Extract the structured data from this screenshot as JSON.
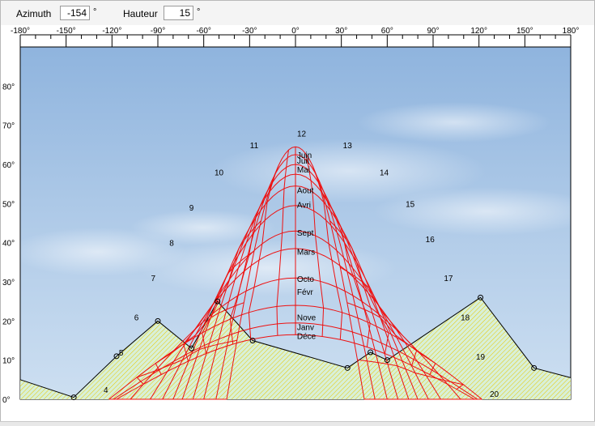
{
  "toolbar": {
    "azimuth_label": "Azimuth",
    "azimuth_value": "-154",
    "azimuth_unit": "°",
    "hauteur_label": "Hauteur",
    "hauteur_value": "15",
    "hauteur_unit": "°"
  },
  "colors": {
    "sun_path_lines": "#ee1111",
    "horizon_line": "#000000",
    "horizon_fill": "#d8f0d8",
    "horizon_hatch": "#e8c800",
    "sky_top": "#8fb4de",
    "sky_bottom": "#cddff1"
  },
  "chart_data": {
    "type": "sun-path-diagram",
    "x_axis": {
      "range": [
        -180,
        180
      ],
      "ticks": [
        -180,
        -150,
        -120,
        -90,
        -60,
        -30,
        0,
        30,
        60,
        90,
        120,
        150,
        180
      ],
      "tick_labels": [
        "-180°",
        "-150°",
        "-120°",
        "-90°",
        "-60°",
        "-30°",
        "0°",
        "30°",
        "60°",
        "90°",
        "120°",
        "150°",
        "180°"
      ]
    },
    "y_axis": {
      "range": [
        0,
        90
      ],
      "ticks": [
        0,
        10,
        20,
        30,
        40,
        50,
        60,
        70,
        80
      ],
      "tick_labels": [
        "0°",
        "10°",
        "20°",
        "30°",
        "40°",
        "50°",
        "60°",
        "70°",
        "80°"
      ]
    },
    "hour_labels": [
      {
        "text": "4",
        "az": -124,
        "el": 2.5
      },
      {
        "text": "5",
        "az": -114,
        "el": 12
      },
      {
        "text": "6",
        "az": -104,
        "el": 21
      },
      {
        "text": "7",
        "az": -93,
        "el": 31
      },
      {
        "text": "8",
        "az": -81,
        "el": 40
      },
      {
        "text": "9",
        "az": -68,
        "el": 49
      },
      {
        "text": "10",
        "az": -50,
        "el": 58
      },
      {
        "text": "11",
        "az": -27,
        "el": 65
      },
      {
        "text": "12",
        "az": 4,
        "el": 68
      },
      {
        "text": "13",
        "az": 34,
        "el": 65
      },
      {
        "text": "14",
        "az": 58,
        "el": 58
      },
      {
        "text": "15",
        "az": 75,
        "el": 50
      },
      {
        "text": "16",
        "az": 88,
        "el": 41
      },
      {
        "text": "17",
        "az": 100,
        "el": 31
      },
      {
        "text": "18",
        "az": 111,
        "el": 21
      },
      {
        "text": "19",
        "az": 121,
        "el": 11
      },
      {
        "text": "20",
        "az": 130,
        "el": 1.5
      }
    ],
    "month_labels": [
      {
        "text": "Juin",
        "el": 62.5
      },
      {
        "text": "Juil",
        "el": 61
      },
      {
        "text": "Mai",
        "el": 58.8
      },
      {
        "text": "Aout",
        "el": 53.5
      },
      {
        "text": "Avri",
        "el": 49.8
      },
      {
        "text": "Sept",
        "el": 42.6
      },
      {
        "text": "Mars",
        "el": 37.8
      },
      {
        "text": "Octo",
        "el": 30.8
      },
      {
        "text": "Févr",
        "el": 27.5
      },
      {
        "text": "Nove",
        "el": 21
      },
      {
        "text": "Janv",
        "el": 18.5
      },
      {
        "text": "Déce",
        "el": 16.2
      }
    ],
    "noon_elevations": [
      16.5,
      19.5,
      24,
      31,
      38.5,
      43,
      49.5,
      54.5,
      57.5,
      60,
      62.5,
      64.5
    ],
    "sunrise_azimuths": [
      -117,
      -119,
      -122,
      -108,
      -95,
      -87,
      -80,
      -74,
      -67,
      -60,
      -52,
      -45
    ],
    "horizon_profile": [
      {
        "az": -180,
        "el": 5
      },
      {
        "az": -145,
        "el": 0.5
      },
      {
        "az": -117,
        "el": 11
      },
      {
        "az": -90,
        "el": 20
      },
      {
        "az": -68,
        "el": 13
      },
      {
        "az": -51,
        "el": 25
      },
      {
        "az": -28,
        "el": 15
      },
      {
        "az": 34,
        "el": 8
      },
      {
        "az": 49,
        "el": 12
      },
      {
        "az": 60,
        "el": 10
      },
      {
        "az": 121,
        "el": 26
      },
      {
        "az": 156,
        "el": 8
      },
      {
        "az": 180,
        "el": 5.5
      }
    ],
    "horizon_markers": [
      -145,
      -117,
      -90,
      -68,
      -51,
      -28,
      34,
      49,
      60,
      121,
      156
    ]
  }
}
